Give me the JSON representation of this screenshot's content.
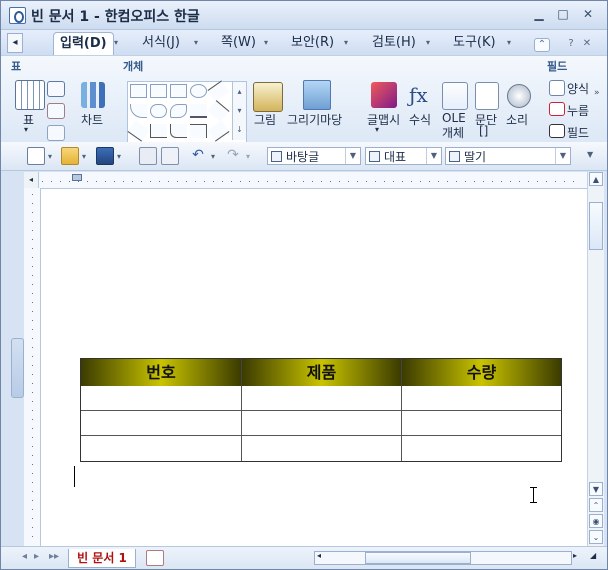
{
  "window": {
    "title": "빈 문서 1 - 한컴오피스 한글"
  },
  "menu": {
    "tabs": [
      {
        "label": "입력(D)",
        "active": true
      },
      {
        "label": "서식(J)"
      },
      {
        "label": "쪽(W)"
      },
      {
        "label": "보안(R)"
      },
      {
        "label": "검토(H)"
      },
      {
        "label": "도구(K)"
      }
    ]
  },
  "ribbon": {
    "groups": {
      "table_group": "표",
      "object_group": "개체",
      "field_group": "필드"
    },
    "buttons": {
      "table": "표",
      "chart": "차트",
      "picture": "그림",
      "drawing_madang": "그리기마당",
      "glyph_text": "글맵시",
      "equation": "수식",
      "ole_line1": "OLE",
      "ole_line2": "개체",
      "paragraph_line1": "문단",
      "paragraph_line2": "[]",
      "sound": "소리",
      "field_form": "양식",
      "field_click": "누름",
      "field_field": "필드"
    }
  },
  "toolbar": {
    "style_value": "바탕글",
    "font_value": "대표",
    "font_name_value": "딸기"
  },
  "document": {
    "table_headers": [
      "번호",
      "제품",
      "수량"
    ]
  },
  "status": {
    "doc_tab": "빈 문서 1"
  }
}
